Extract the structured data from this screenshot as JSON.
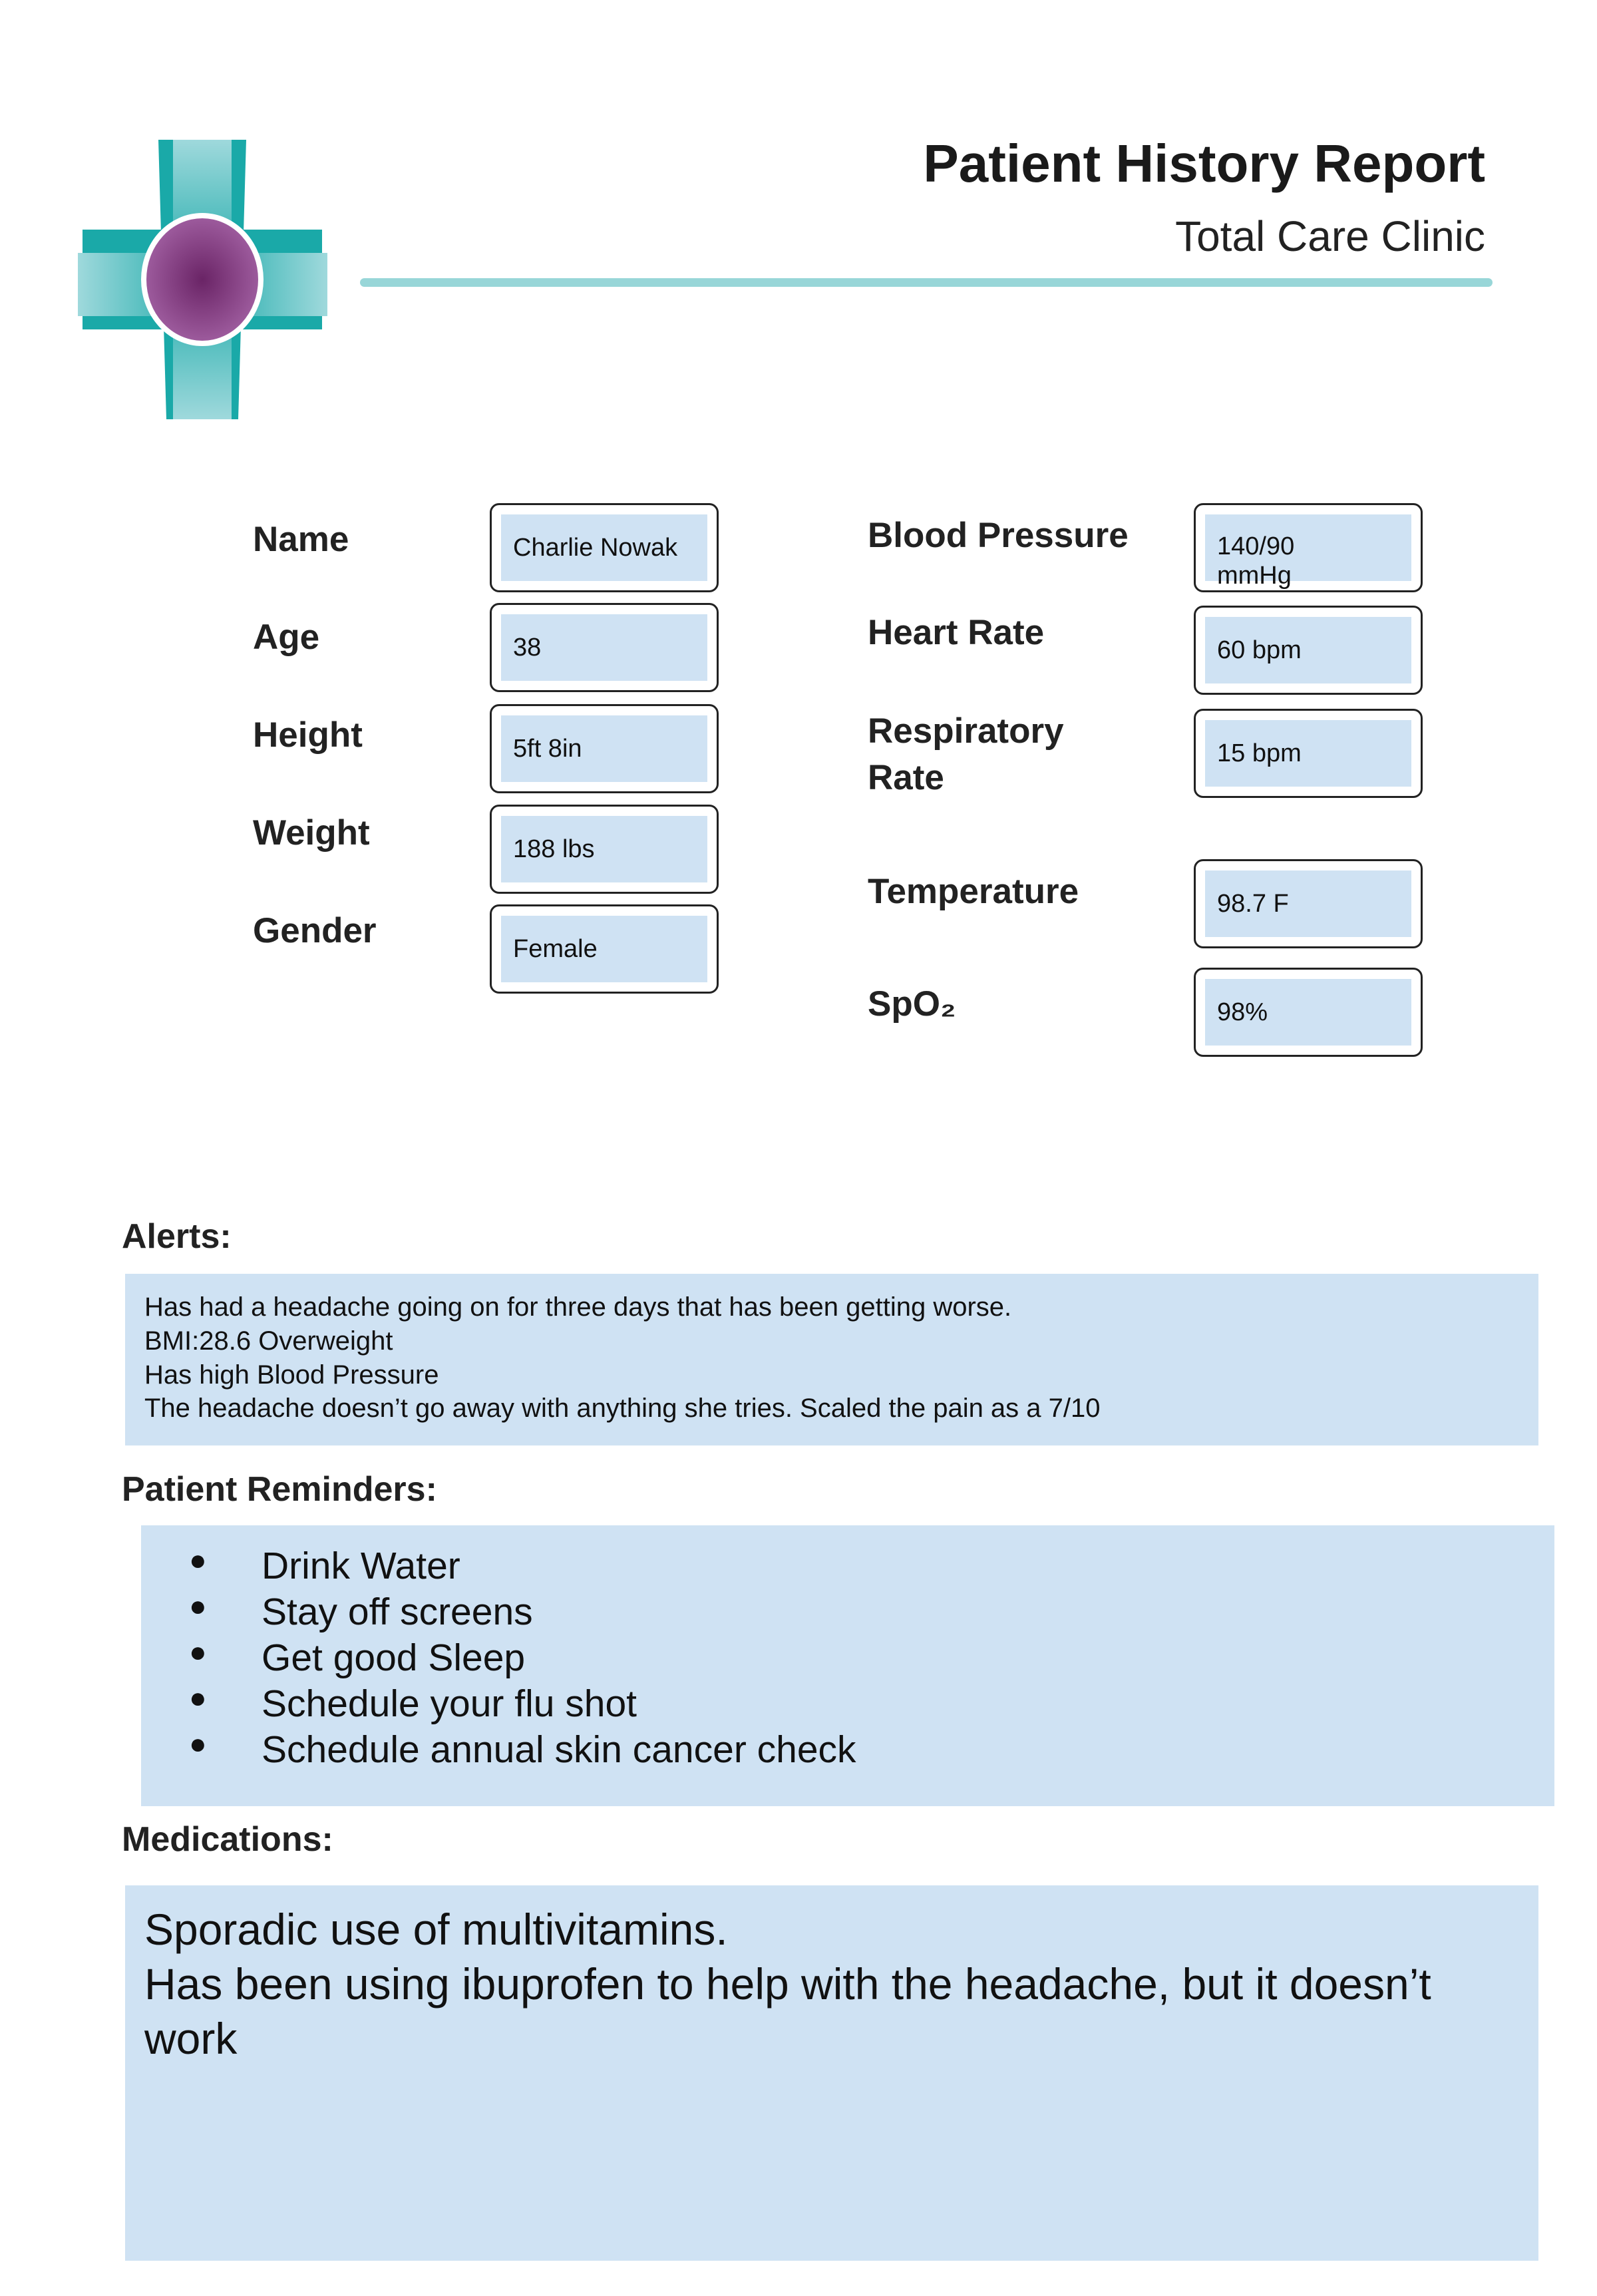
{
  "header": {
    "title": "Patient History Report",
    "clinic": "Total Care Clinic",
    "accent_color": "#98d6d8",
    "logo_icon": "medical-cross-logo"
  },
  "patient": [
    {
      "label": "Name",
      "value": "Charlie Nowak"
    },
    {
      "label": "Age",
      "value": "38"
    },
    {
      "label": "Height",
      "value": "5ft 8in"
    },
    {
      "label": "Weight",
      "value": "188 lbs"
    },
    {
      "label": "Gender",
      "value": "Female"
    }
  ],
  "vitals": [
    {
      "label": "Blood Pressure",
      "value": "140/90 mmHg"
    },
    {
      "label": "Heart Rate",
      "value": "60 bpm"
    },
    {
      "label": "Respiratory Rate",
      "value": "15 bpm"
    },
    {
      "label": "Temperature",
      "value": "98.7 F"
    },
    {
      "label": "SpO₂",
      "value": "98%"
    }
  ],
  "alerts": {
    "heading": "Alerts:",
    "lines": [
      "Has had a headache going on for three days that has been getting worse.",
      "BMI:28.6 Overweight",
      "Has high Blood Pressure",
      "The headache doesn’t go away with anything she tries. Scaled the pain as a 7/10"
    ]
  },
  "reminders": {
    "heading": "Patient Reminders:",
    "bullet": "●",
    "items": [
      "Drink Water",
      "Stay off screens",
      "Get good Sleep",
      "Schedule your flu shot",
      "Schedule annual skin cancer check"
    ]
  },
  "medications": {
    "heading": "Medications:",
    "lines": [
      "Sporadic use of multivitamins.",
      "Has been using ibuprofen to help with the headache, but it doesn’t",
      "work"
    ]
  },
  "colors": {
    "field_fill": "#cfe2f3",
    "logo_teal": "#1aa9a8",
    "logo_purple": "#7a3a7e"
  }
}
